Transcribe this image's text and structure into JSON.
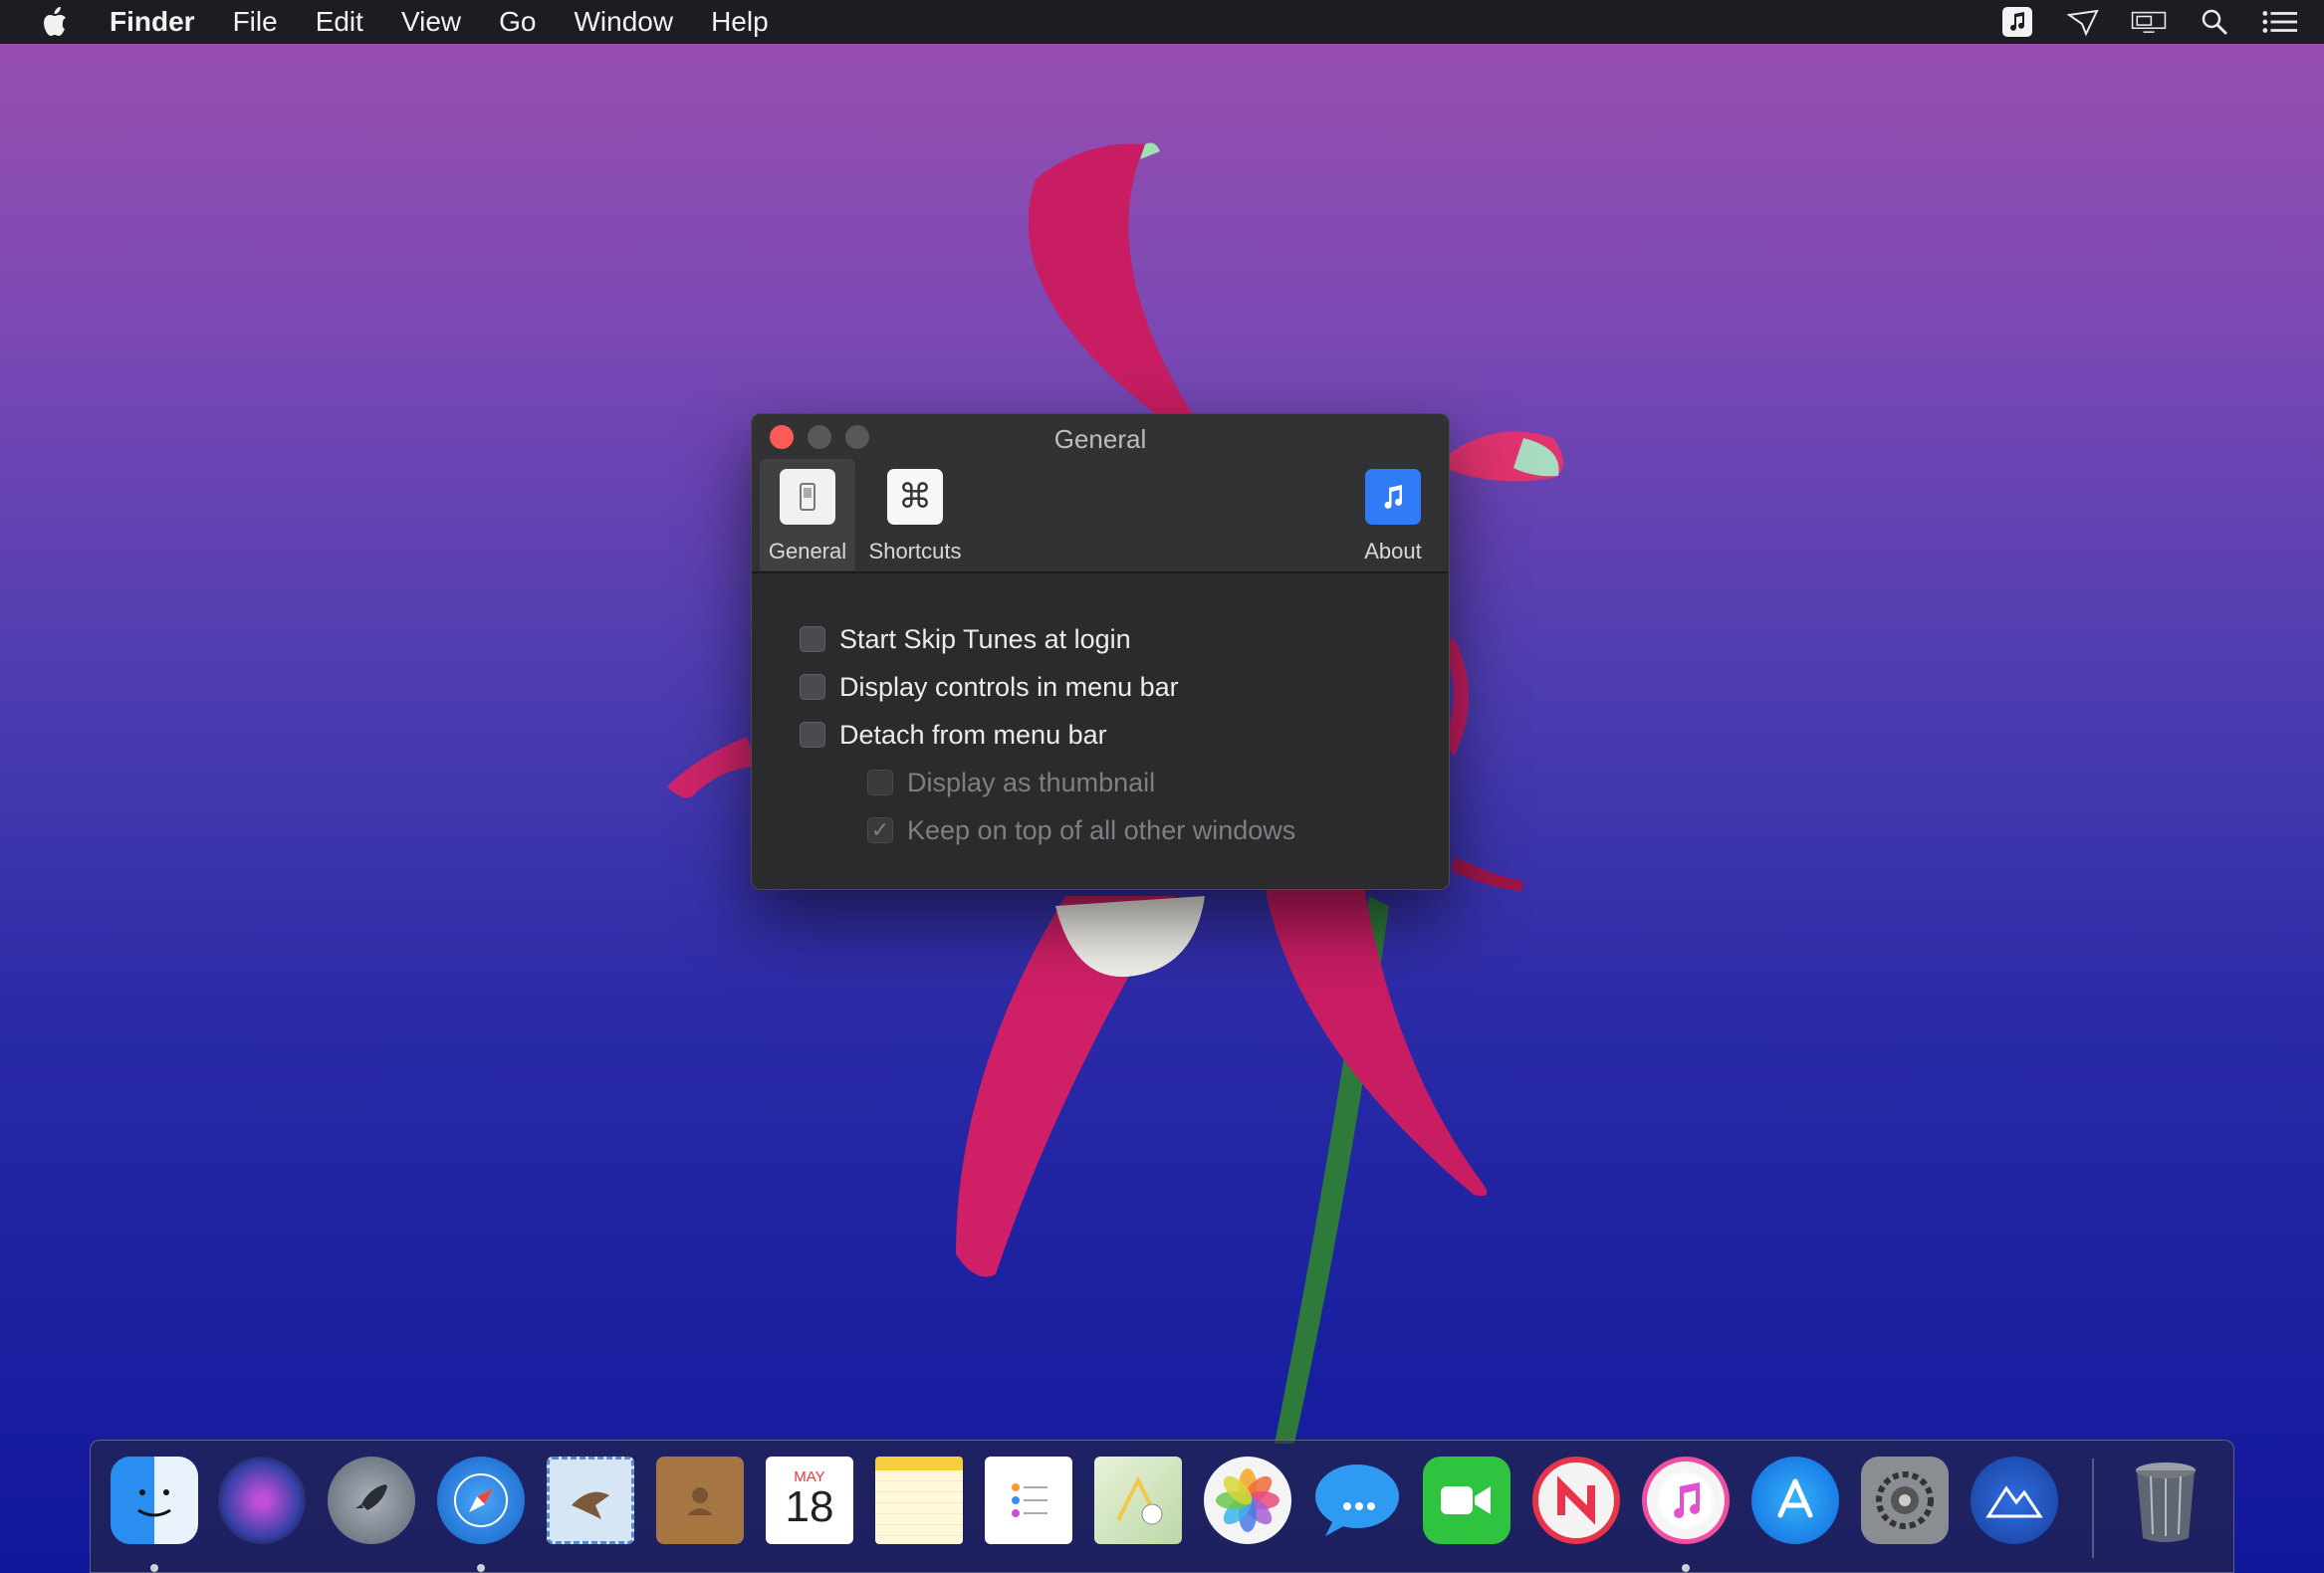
{
  "menubar": {
    "app_name": "Finder",
    "items": [
      "File",
      "Edit",
      "View",
      "Go",
      "Window",
      "Help"
    ],
    "right_icons": [
      "music-note-icon",
      "airdrop-icon",
      "display-mirroring-icon",
      "spotlight-search-icon",
      "notification-center-icon"
    ]
  },
  "window": {
    "title": "General",
    "toolbar": {
      "general_label": "General",
      "shortcuts_label": "Shortcuts",
      "about_label": "About"
    },
    "options": {
      "start_at_login": "Start Skip Tunes at login",
      "display_controls": "Display controls in menu bar",
      "detach": "Detach from menu bar",
      "thumbnail": "Display as thumbnail",
      "keep_on_top": "Keep on top of all other windows"
    },
    "checked": {
      "start_at_login": false,
      "display_controls": false,
      "detach": false,
      "thumbnail": false,
      "keep_on_top": true
    }
  },
  "calendar": {
    "month": "MAY",
    "day": "18"
  },
  "dock": {
    "apps": [
      "finder-icon",
      "siri-icon",
      "launchpad-icon",
      "safari-icon",
      "mail-icon",
      "contacts-icon",
      "calendar-icon",
      "notes-icon",
      "reminders-icon",
      "maps-icon",
      "photos-icon",
      "messages-icon",
      "facetime-icon",
      "news-icon",
      "itunes-icon",
      "app-store-icon",
      "system-preferences-icon",
      "macos-installer-icon",
      "trash-icon"
    ],
    "running": [
      "finder-icon",
      "safari-icon",
      "itunes-icon"
    ]
  },
  "colors": {
    "close_button": "#fd5b55",
    "accent": "#2f7cf6"
  }
}
